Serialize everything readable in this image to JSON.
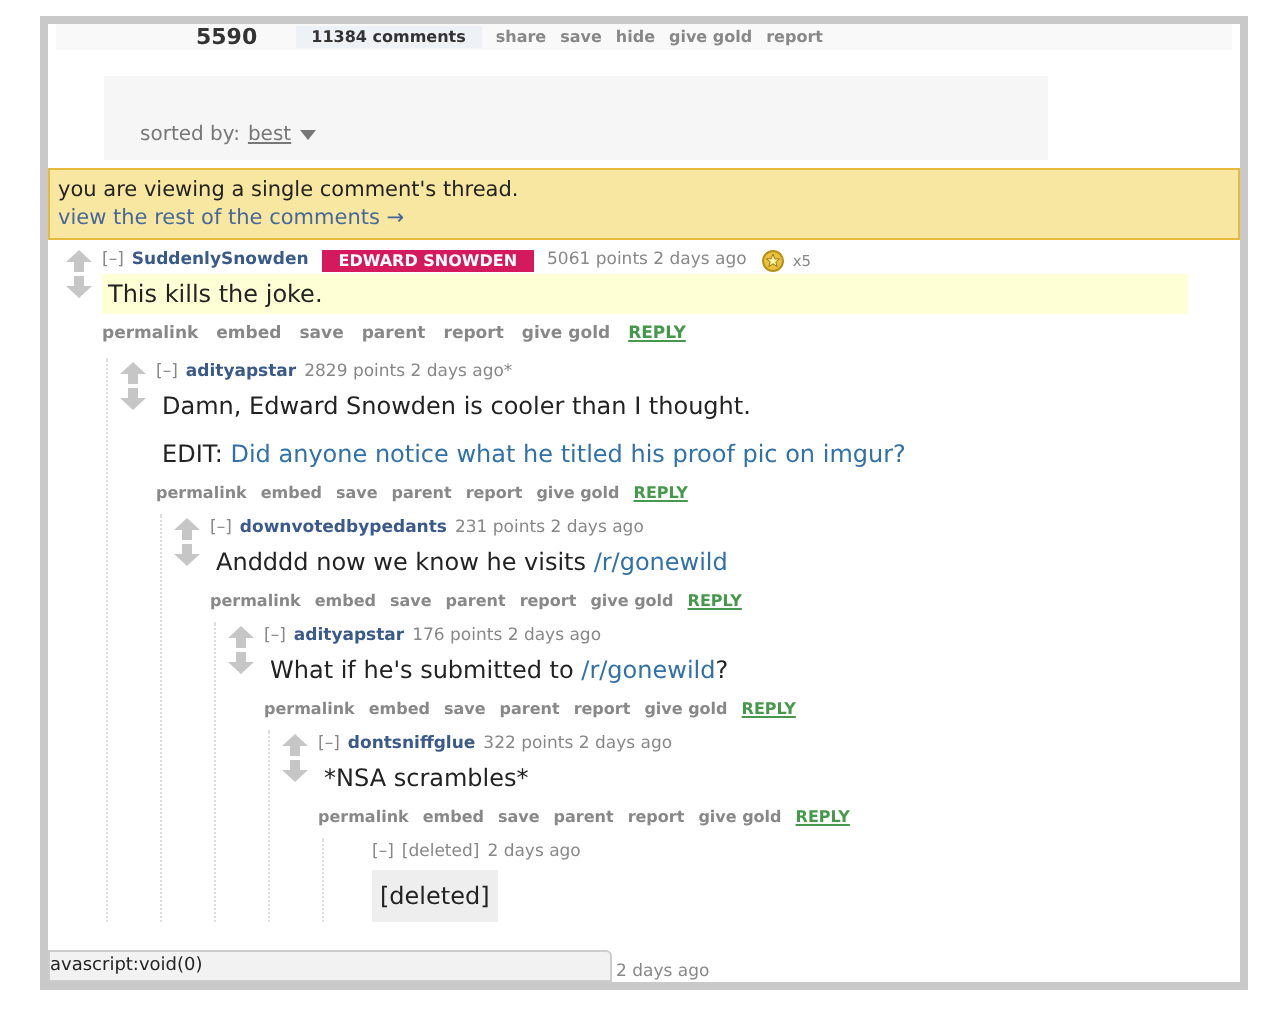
{
  "post_bar": {
    "score": "5590",
    "actions": [
      {
        "label": "11384 comments",
        "kind": "comments"
      },
      {
        "label": "share",
        "kind": "plain"
      },
      {
        "label": "save",
        "kind": "plain"
      },
      {
        "label": "hide",
        "kind": "plain"
      },
      {
        "label": "give gold",
        "kind": "plain"
      },
      {
        "label": "report",
        "kind": "plain"
      }
    ]
  },
  "sort": {
    "label": "sorted by:",
    "value": "best"
  },
  "notice": {
    "text": "you are viewing a single comment's thread.",
    "link": "view the rest of the comments →"
  },
  "comments": [
    {
      "collapse": "[–]",
      "author": "SuddenlySnowden",
      "flair": "EDWARD SNOWDEN",
      "meta": "5061 points 2 days ago",
      "gilded": "x5",
      "highlighted": true,
      "body": [
        {
          "kind": "text",
          "text": "This kills the joke."
        }
      ],
      "actions": [
        "permalink",
        "embed",
        "save",
        "parent",
        "report",
        "give gold",
        "REPLY"
      ],
      "children": [
        {
          "collapse": "[–]",
          "author": "adityapstar",
          "meta": "2829 points 2 days ago*",
          "body": [
            {
              "kind": "text",
              "text": "Damn, Edward Snowden is cooler than I thought."
            }
          ],
          "edit": [
            {
              "kind": "text",
              "text": "EDIT: "
            },
            {
              "kind": "link",
              "text": "Did anyone notice what he titled his proof pic on imgur?"
            }
          ],
          "actions": [
            "permalink",
            "embed",
            "save",
            "parent",
            "report",
            "give gold",
            "REPLY"
          ],
          "children": [
            {
              "collapse": "[–]",
              "author": "downvotedbypedants",
              "meta": "231 points 2 days ago",
              "body": [
                {
                  "kind": "text",
                  "text": "Andddd now we know he visits "
                },
                {
                  "kind": "link",
                  "text": "/r/gonewild"
                }
              ],
              "actions": [
                "permalink",
                "embed",
                "save",
                "parent",
                "report",
                "give gold",
                "REPLY"
              ],
              "children": [
                {
                  "collapse": "[–]",
                  "author": "adityapstar",
                  "meta": "176 points 2 days ago",
                  "body": [
                    {
                      "kind": "text",
                      "text": "What if he's submitted to "
                    },
                    {
                      "kind": "link",
                      "text": "/r/gonewild"
                    },
                    {
                      "kind": "text",
                      "text": "?"
                    }
                  ],
                  "actions": [
                    "permalink",
                    "embed",
                    "save",
                    "parent",
                    "report",
                    "give gold",
                    "REPLY"
                  ],
                  "children": [
                    {
                      "collapse": "[–]",
                      "author": "dontsniffglue",
                      "meta": "322 points 2 days ago",
                      "body": [
                        {
                          "kind": "text",
                          "text": "*NSA scrambles*"
                        }
                      ],
                      "actions": [
                        "permalink",
                        "embed",
                        "save",
                        "parent",
                        "report",
                        "give gold",
                        "REPLY"
                      ],
                      "children": [
                        {
                          "collapse": "[–]",
                          "author": "[deleted]",
                          "meta": "2 days ago",
                          "deleted": true,
                          "body": [
                            {
                              "kind": "text",
                              "text": "[deleted]"
                            }
                          ]
                        }
                      ]
                    }
                  ]
                }
              ]
            }
          ]
        }
      ]
    }
  ],
  "cut_comment": {
    "meta": "2 days ago"
  },
  "status_bar": {
    "text": "avascript:void(0)"
  }
}
